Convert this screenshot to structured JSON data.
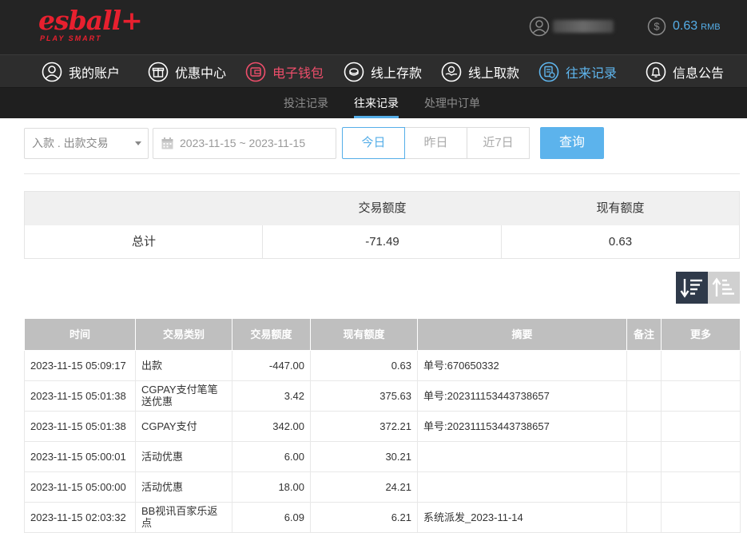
{
  "brand": {
    "name": "esball+",
    "tagline": "PLAY SMART"
  },
  "header": {
    "balance_value": "0.63",
    "balance_unit": "RMB"
  },
  "nav": [
    {
      "label": "我的账户"
    },
    {
      "label": "优惠中心"
    },
    {
      "label": "电子钱包"
    },
    {
      "label": "线上存款"
    },
    {
      "label": "线上取款"
    },
    {
      "label": "往来记录"
    },
    {
      "label": "信息公告"
    }
  ],
  "nav_active_index": 5,
  "subnav": [
    {
      "label": "投注记录"
    },
    {
      "label": "往来记录"
    },
    {
      "label": "处理中订单"
    }
  ],
  "subnav_active_index": 1,
  "filter": {
    "type_select_value": "入款 . 出款交易",
    "date_range": "2023-11-15 ~ 2023-11-15",
    "date_buttons": [
      "今日",
      "昨日",
      "近7日"
    ],
    "active_date_button": "今日",
    "query_label": "查询"
  },
  "summary": {
    "headers": [
      "",
      "交易额度",
      "现有额度"
    ],
    "row_label": "总计",
    "transaction_total": "-71.49",
    "current_balance": "0.63"
  },
  "sort": {
    "active": "desc"
  },
  "colors": {
    "accent": "#55aee8",
    "wallet_red": "#ef4e6b",
    "brand_red": "#e8202f",
    "header_bg": "#242424"
  },
  "table": {
    "headers": [
      "时间",
      "交易类别",
      "交易额度",
      "现有额度",
      "摘要",
      "备注",
      "更多"
    ],
    "rows": [
      {
        "time": "2023-11-15 05:09:17",
        "type": "出款",
        "amount": "-447.00",
        "balance": "0.63",
        "summary": "单号:670650332",
        "note": "",
        "more": ""
      },
      {
        "time": "2023-11-15 05:01:38",
        "type": "CGPAY支付笔笔送优惠",
        "amount": "3.42",
        "balance": "375.63",
        "summary": "单号:202311153443738657",
        "note": "",
        "more": ""
      },
      {
        "time": "2023-11-15 05:01:38",
        "type": "CGPAY支付",
        "amount": "342.00",
        "balance": "372.21",
        "summary": "单号:202311153443738657",
        "note": "",
        "more": ""
      },
      {
        "time": "2023-11-15 05:00:01",
        "type": "活动优惠",
        "amount": "6.00",
        "balance": "30.21",
        "summary": "",
        "note": "",
        "more": ""
      },
      {
        "time": "2023-11-15 05:00:00",
        "type": "活动优惠",
        "amount": "18.00",
        "balance": "24.21",
        "summary": "",
        "note": "",
        "more": ""
      },
      {
        "time": "2023-11-15 02:03:32",
        "type": "BB视讯百家乐返点",
        "amount": "6.09",
        "balance": "6.21",
        "summary": "系统派发_2023-11-14",
        "note": "",
        "more": ""
      }
    ]
  }
}
